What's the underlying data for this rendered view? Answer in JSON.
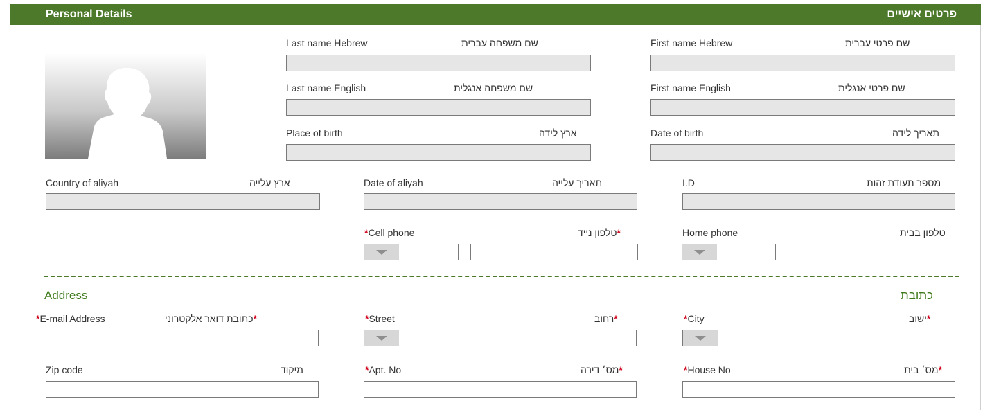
{
  "header": {
    "title_en": "Personal Details",
    "title_he": "פרטים אישיים"
  },
  "personal": {
    "last_name_hebrew": {
      "en": "Last name Hebrew",
      "he": "שם משפחה עברית",
      "value": ""
    },
    "first_name_hebrew": {
      "en": "First name Hebrew",
      "he": "שם פרטי עברית",
      "value": ""
    },
    "last_name_english": {
      "en": "Last name English",
      "he": "שם משפחה אנגלית",
      "value": ""
    },
    "first_name_english": {
      "en": "First name English",
      "he": "שם פרטי אנגלית",
      "value": ""
    },
    "place_of_birth": {
      "en": "Place of birth",
      "he": "ארץ לידה",
      "value": ""
    },
    "date_of_birth": {
      "en": "Date of birth",
      "he": "תאריך לידה",
      "value": ""
    },
    "country_of_aliyah": {
      "en": "Country of aliyah",
      "he": "ארץ עלייה",
      "value": ""
    },
    "date_of_aliyah": {
      "en": "Date of aliyah",
      "he": "תאריך עלייה",
      "value": ""
    },
    "id_number": {
      "en": "I.D",
      "he": "מספר תעודת זהות",
      "value": ""
    },
    "cell_phone": {
      "en": "Cell phone",
      "he": "טלפון נייד",
      "value": ""
    },
    "home_phone": {
      "en": "Home phone",
      "he": "טלפון בבית",
      "value": ""
    }
  },
  "address": {
    "title_en": "Address",
    "title_he": "כתובת",
    "email": {
      "en": "E-mail Address",
      "he": "כתובת דואר אלקטרוני",
      "value": ""
    },
    "street": {
      "en": "Street",
      "he": "רחוב",
      "value": ""
    },
    "city": {
      "en": "City",
      "he": "ישוב",
      "value": ""
    },
    "zip_code": {
      "en": "Zip code",
      "he": "מיקוד",
      "value": ""
    },
    "apt_no": {
      "en": "Apt. No",
      "he": "מס׳ דירה",
      "value": ""
    },
    "house_no": {
      "en": "House No",
      "he": "מס׳ בית",
      "value": ""
    }
  },
  "icons": {
    "photo": "person-silhouette-icon",
    "dropdown": "triangle-down-icon"
  },
  "colors": {
    "header_bg": "#4d7a2a",
    "section_title": "#3f7a1c",
    "required": "#d0021b",
    "field_disabled": "#e6e6e6"
  }
}
